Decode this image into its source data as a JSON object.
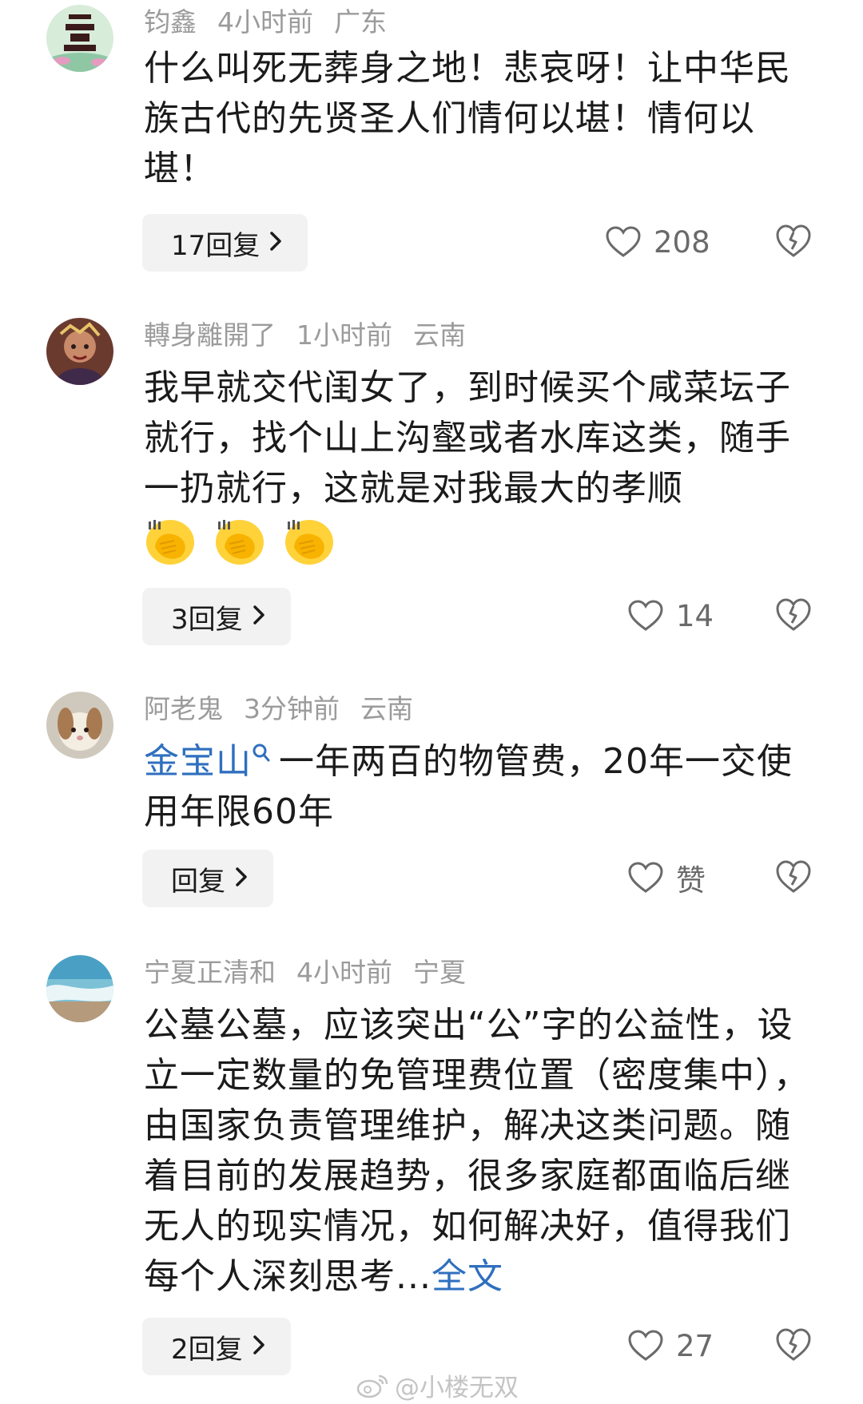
{
  "comments": [
    {
      "username": "钧鑫",
      "time": "4小时前",
      "location": "广东",
      "text": "什么叫死无葬身之地！悲哀呀！让中华民族古代的先贤圣人们情何以堪！情何以堪！",
      "reply_label": "17回复",
      "likes": "208"
    },
    {
      "username": "轉身離開了",
      "time": "1小时前",
      "location": "云南",
      "text": "我早就交代闺女了，到时候买个咸菜坛子就行，找个山上沟壑或者水库这类，随手一扔就行，这就是对我最大的孝顺",
      "emoji": [
        "face-palm-emoji",
        "face-palm-emoji",
        "face-palm-emoji"
      ],
      "reply_label": "3回复",
      "likes": "14"
    },
    {
      "username": "阿老鬼",
      "time": "3分钟前",
      "location": "云南",
      "link": "金宝山",
      "text": "一年两百的物管费，20年一交使用年限60年",
      "reply_label": "回复",
      "likes": "赞"
    },
    {
      "username": "宁夏正清和",
      "time": "4小时前",
      "location": "宁夏",
      "text": "公墓公墓，应该突出“公”字的公益性，设立一定数量的免管理费位置（密度集中），由国家负责管理维护，解决这类问题。随着目前的发展趋势，很多家庭都面临后继无人的现实情况，如何解决好，值得我们每个人深刻思考...",
      "more_label": "全文",
      "reply_label": "2回复",
      "likes": "27"
    }
  ],
  "watermark": "@小楼无双",
  "colors": {
    "link": "#2f6fbf",
    "meta": "#9b9b9b",
    "reply_bg": "#f2f2f2"
  }
}
